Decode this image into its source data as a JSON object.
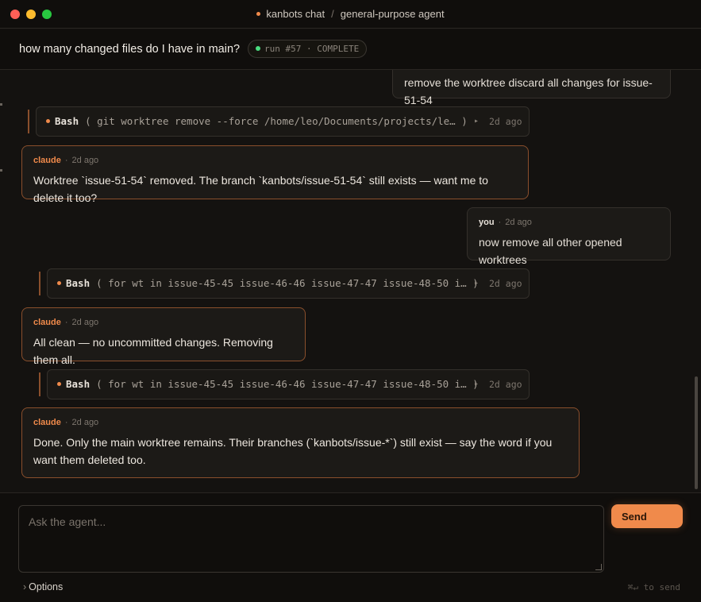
{
  "window": {
    "app": "kanbots chat",
    "separator": "/",
    "agent": "general-purpose agent"
  },
  "header": {
    "question": "how many changed files do I have in main?",
    "run_label": "run #57 · COMPLETE"
  },
  "messages": {
    "user_1": {
      "text": "remove the worktree discard all changes for issue-51-54"
    },
    "tool_1": {
      "name": "Bash",
      "args": "( git worktree remove --force /home/leo/Documents/projects/le… )",
      "arrow": "▸",
      "time": "2d ago"
    },
    "claude_1": {
      "author": "claude",
      "sep": "·",
      "time": "2d ago",
      "text": "Worktree `issue-51-54` removed. The branch `kanbots/issue-51-54` still exists — want me to delete it too?"
    },
    "user_2": {
      "author": "you",
      "sep": "·",
      "time": "2d ago",
      "text": "now remove all other opened worktrees"
    },
    "tool_2": {
      "name": "Bash",
      "args": "( for wt in issue-45-45 issue-46-46 issue-47-47 issue-48-50 i… )",
      "arrow": "▸",
      "time": "2d ago"
    },
    "claude_2": {
      "author": "claude",
      "sep": "·",
      "time": "2d ago",
      "text": "All clean — no uncommitted changes. Removing them all."
    },
    "tool_3": {
      "name": "Bash",
      "args": "( for wt in issue-45-45 issue-46-46 issue-47-47 issue-48-50 i… )",
      "arrow": "▸",
      "time": "2d ago"
    },
    "claude_3": {
      "author": "claude",
      "sep": "·",
      "time": "2d ago",
      "text": "Done. Only the main worktree remains. Their branches (`kanbots/issue-*`) still exist — say the word if you want them deleted too."
    }
  },
  "composer": {
    "placeholder": "Ask the agent...",
    "send_label": "Send",
    "options_label": "Options",
    "options_chevron": "›",
    "hint": "⌘↵ to send"
  },
  "colors": {
    "accent": "#f08a4b",
    "status_ok": "#4ade80",
    "background": "#141210"
  }
}
